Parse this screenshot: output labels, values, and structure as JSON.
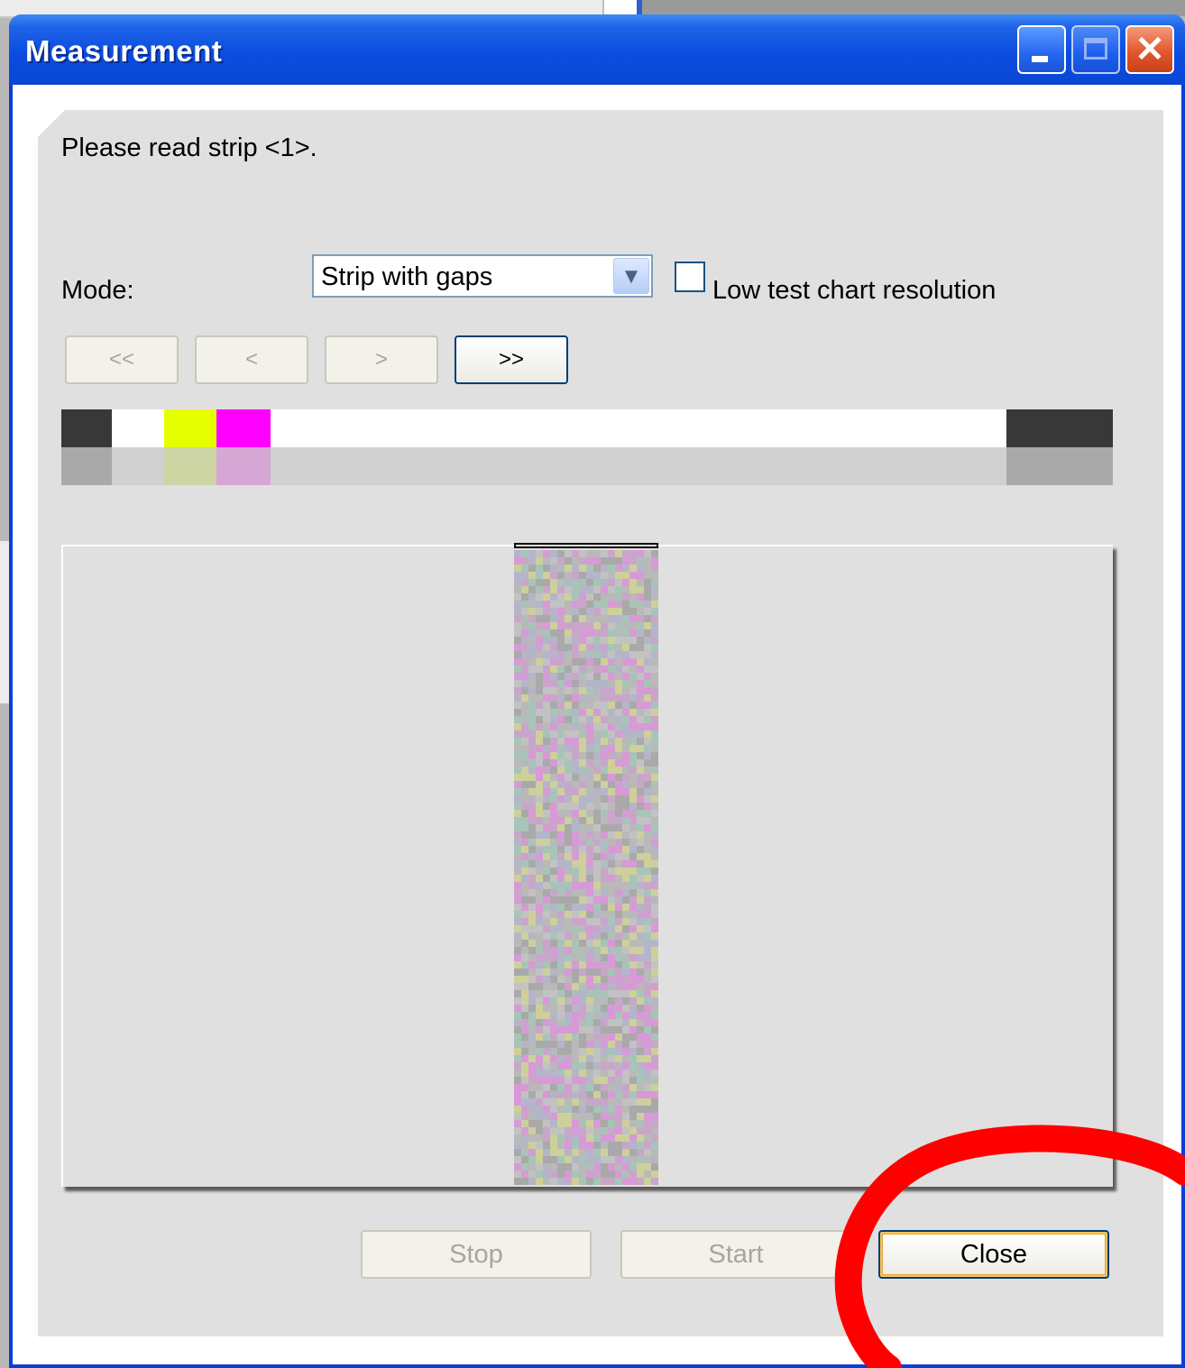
{
  "window": {
    "title": "Measurement"
  },
  "titlebar_icons": [
    "minimize-icon",
    "maximize-icon",
    "close-icon"
  ],
  "prompt": {
    "text": "Please read strip <1>."
  },
  "mode": {
    "label": "Mode:",
    "selected": "Strip with gaps",
    "checkbox_label": "Low test chart resolution",
    "checkbox_checked": false
  },
  "nav": {
    "first": "<<",
    "prev": "<",
    "next": ">",
    "last": ">>"
  },
  "strip_patches": {
    "top_colors": [
      "#383838",
      "#ffffff",
      "#e6ff00",
      "#ff00ff",
      "#383838"
    ],
    "bottom_colors": [
      "#a9a9a9",
      "#d1d1d1",
      "#cdd5a4",
      "#d6a6d4",
      "#a9a9a9"
    ]
  },
  "preview": {
    "palette": [
      "#c9a6c9",
      "#b9b9b9",
      "#a8c4b8",
      "#cdd09a",
      "#b5b5c9",
      "#d79ad6",
      "#a9a9a9",
      "#c2c2c2"
    ]
  },
  "buttons": {
    "stop": "Stop",
    "start": "Start",
    "close": "Close"
  },
  "annotation": {
    "color": "#ff0000"
  }
}
